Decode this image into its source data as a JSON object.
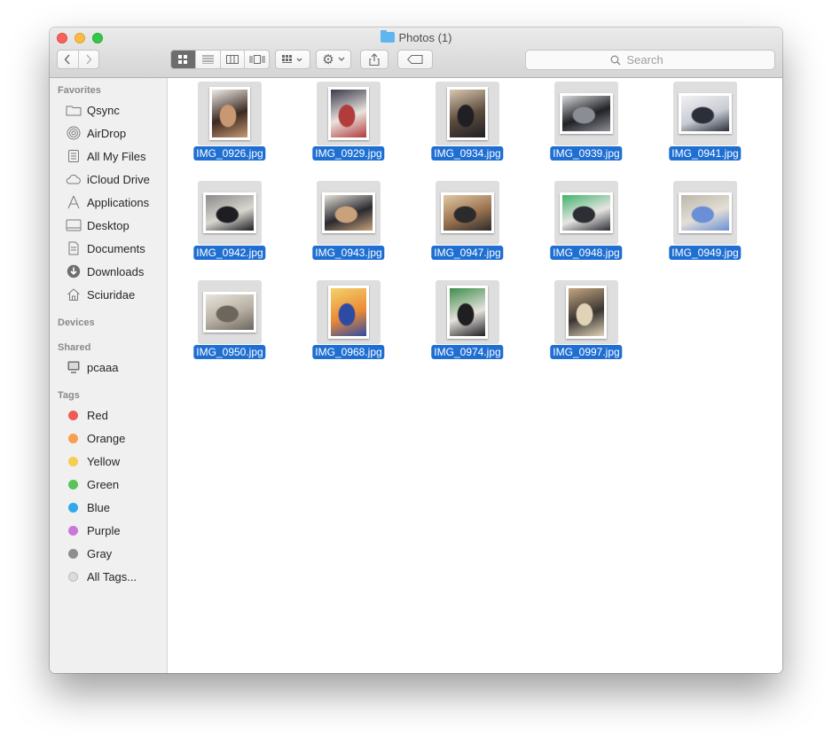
{
  "window": {
    "title": "Photos (1)",
    "search_placeholder": "Search"
  },
  "sidebar": {
    "favorites_header": "Favorites",
    "favorites": [
      {
        "label": "Qsync",
        "icon": "folder-icon"
      },
      {
        "label": "AirDrop",
        "icon": "airdrop-icon"
      },
      {
        "label": "All My Files",
        "icon": "all-files-icon"
      },
      {
        "label": "iCloud Drive",
        "icon": "cloud-icon"
      },
      {
        "label": "Applications",
        "icon": "applications-icon"
      },
      {
        "label": "Desktop",
        "icon": "desktop-icon"
      },
      {
        "label": "Documents",
        "icon": "documents-icon"
      },
      {
        "label": "Downloads",
        "icon": "downloads-icon"
      },
      {
        "label": "Sciuridae",
        "icon": "home-icon"
      }
    ],
    "devices_header": "Devices",
    "shared_header": "Shared",
    "shared": [
      {
        "label": "pcaaa",
        "icon": "computer-icon"
      }
    ],
    "tags_header": "Tags",
    "tags": [
      {
        "label": "Red",
        "color": "#f05b57"
      },
      {
        "label": "Orange",
        "color": "#f6a04d"
      },
      {
        "label": "Yellow",
        "color": "#f5cd4f"
      },
      {
        "label": "Green",
        "color": "#5ac35b"
      },
      {
        "label": "Blue",
        "color": "#2fa9eb"
      },
      {
        "label": "Purple",
        "color": "#c978d9"
      },
      {
        "label": "Gray",
        "color": "#8e8e8e"
      },
      {
        "label": "All Tags...",
        "color": "#dcdcdc"
      }
    ]
  },
  "files": [
    {
      "name": "IMG_0926.jpg",
      "orientation": "portrait",
      "colors": [
        "#3b2a22",
        "#c89873",
        "#f0ebe6"
      ]
    },
    {
      "name": "IMG_0929.jpg",
      "orientation": "portrait",
      "colors": [
        "#e8e3de",
        "#b23b3b",
        "#3a3a4a"
      ]
    },
    {
      "name": "IMG_0934.jpg",
      "orientation": "portrait",
      "colors": [
        "#5a4a3c",
        "#1f1f24",
        "#d9c7b0"
      ]
    },
    {
      "name": "IMG_0939.jpg",
      "orientation": "landscape",
      "colors": [
        "#202226",
        "#8a8d93",
        "#d8d8dc"
      ]
    },
    {
      "name": "IMG_0941.jpg",
      "orientation": "landscape",
      "colors": [
        "#c9ccd4",
        "#2b2f3a",
        "#f1f1f1"
      ]
    },
    {
      "name": "IMG_0942.jpg",
      "orientation": "landscape",
      "colors": [
        "#d9d6cf",
        "#1e1e22",
        "#8a8a8a"
      ]
    },
    {
      "name": "IMG_0943.jpg",
      "orientation": "landscape",
      "colors": [
        "#2a2a30",
        "#c9a27c",
        "#e5e0d8"
      ]
    },
    {
      "name": "IMG_0947.jpg",
      "orientation": "landscape",
      "colors": [
        "#9a7250",
        "#2b2b2b",
        "#e0c8a4"
      ]
    },
    {
      "name": "IMG_0948.jpg",
      "orientation": "landscape",
      "colors": [
        "#e7e5e2",
        "#2d2d36",
        "#3fb36a"
      ]
    },
    {
      "name": "IMG_0949.jpg",
      "orientation": "landscape",
      "colors": [
        "#e3dfd6",
        "#6a8fd6",
        "#bdb7aa"
      ]
    },
    {
      "name": "IMG_0950.jpg",
      "orientation": "landscape",
      "colors": [
        "#b7afa2",
        "#6d665d",
        "#e8e4dc"
      ]
    },
    {
      "name": "IMG_0968.jpg",
      "orientation": "portrait",
      "colors": [
        "#ec8a35",
        "#2e4ba3",
        "#f3d26a"
      ]
    },
    {
      "name": "IMG_0974.jpg",
      "orientation": "portrait",
      "colors": [
        "#e6e2dc",
        "#1f1f22",
        "#3d8e4b"
      ]
    },
    {
      "name": "IMG_0997.jpg",
      "orientation": "portrait",
      "colors": [
        "#3a3532",
        "#e0d3b8",
        "#c4a680"
      ]
    }
  ]
}
